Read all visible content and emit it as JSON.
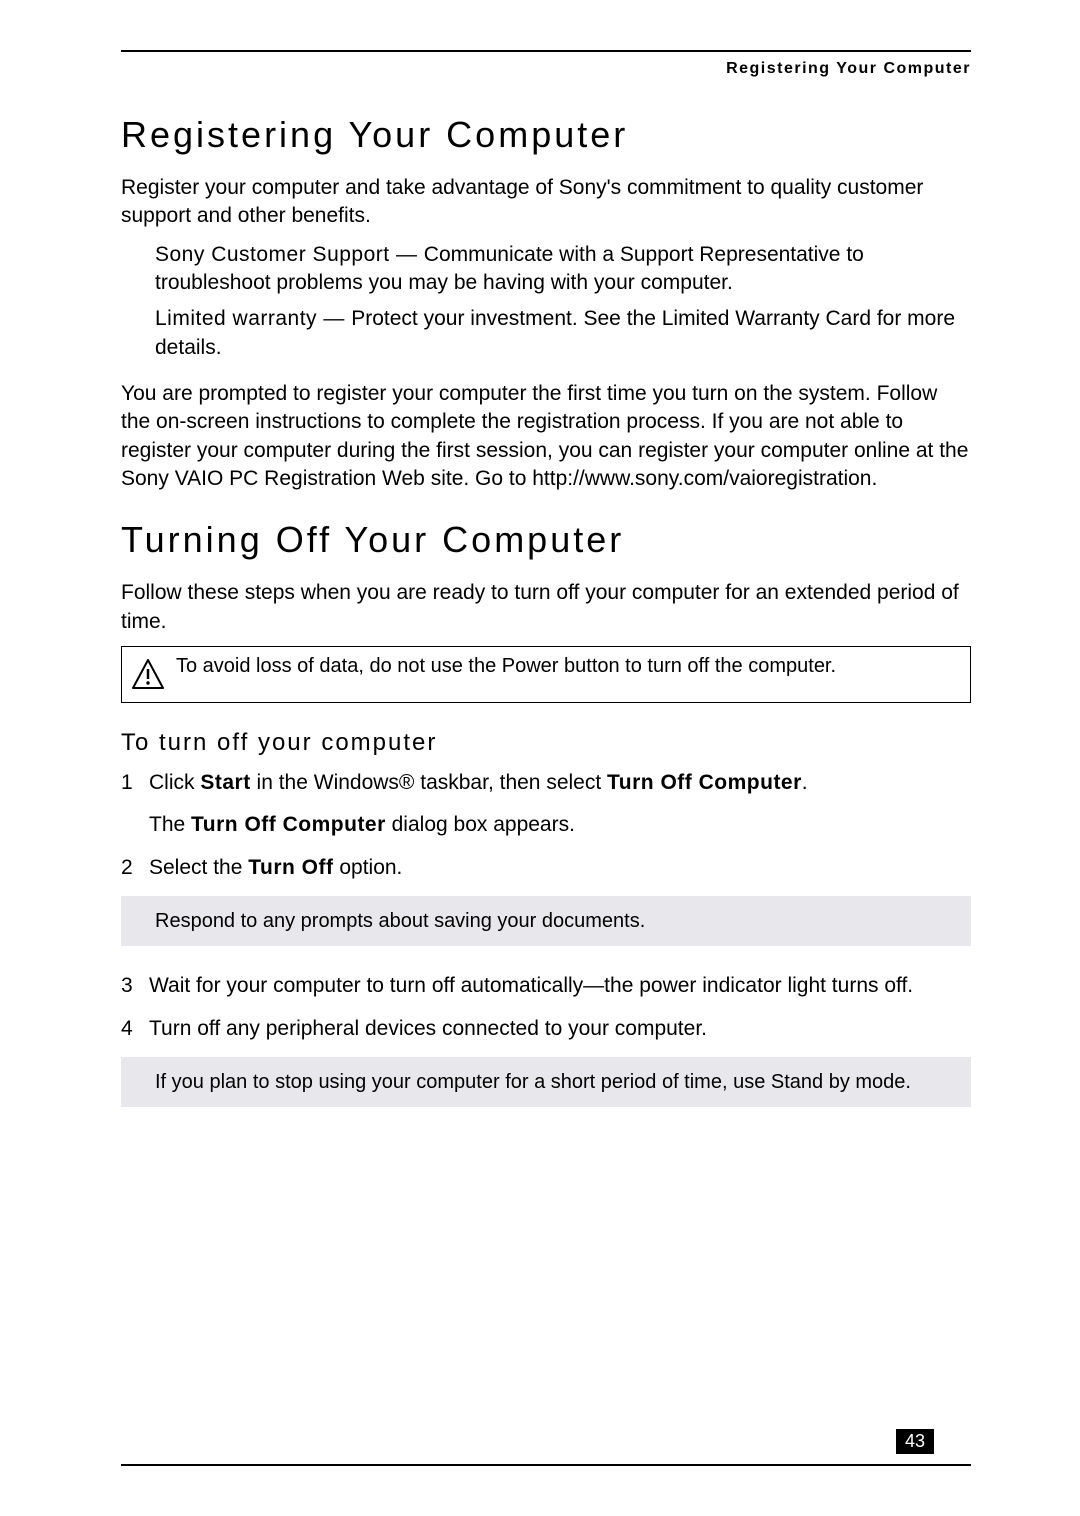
{
  "running_header": "Registering Your Computer",
  "sections": {
    "registering": {
      "heading": "Registering Your Computer",
      "intro": "Register your computer and take advantage of Sony's commitment to quality customer support and other benefits.",
      "benefits": [
        {
          "lead": "Sony Customer Support — ",
          "rest": "Communicate with a Support Representative to troubleshoot problems you may be having with your computer."
        },
        {
          "lead": "Limited warranty — ",
          "rest": "Protect your investment. See the Limited Warranty Card for more details."
        }
      ],
      "para2": "You are prompted to register your computer the first time you turn on the system. Follow the on-screen instructions to complete the registration process. If you are not able to register your computer during the first session, you can register your computer online at the Sony VAIO PC Registration Web site. Go to http://www.sony.com/vaioregistration."
    },
    "turning_off": {
      "heading": "Turning Off Your Computer",
      "intro": "Follow these steps when you are ready to turn off your computer for an extended period of time.",
      "caution": "To avoid loss of data, do not use the Power button to turn off the computer.",
      "subheading": "To turn off your computer",
      "steps": [
        {
          "num": "1",
          "pre": "Click ",
          "bold1": "Start",
          "mid": " in the Windows® taskbar, then select ",
          "bold2": "Turn Off Computer",
          "post": ".",
          "sub_pre": "The ",
          "sub_bold": "Turn Off Computer",
          "sub_post": " dialog box appears."
        },
        {
          "num": "2",
          "pre": "Select the ",
          "bold1": "Turn Off",
          "post": " option."
        }
      ],
      "note1": "Respond to any prompts about saving your documents.",
      "steps2": [
        {
          "num": "3",
          "text": "Wait for your computer to turn off automatically—the power indicator light turns off."
        },
        {
          "num": "4",
          "text": "Turn off any peripheral devices connected to your computer."
        }
      ],
      "note2": "If you plan to stop using your computer for a short period of time, use Stand by mode."
    }
  },
  "page_number": "43"
}
